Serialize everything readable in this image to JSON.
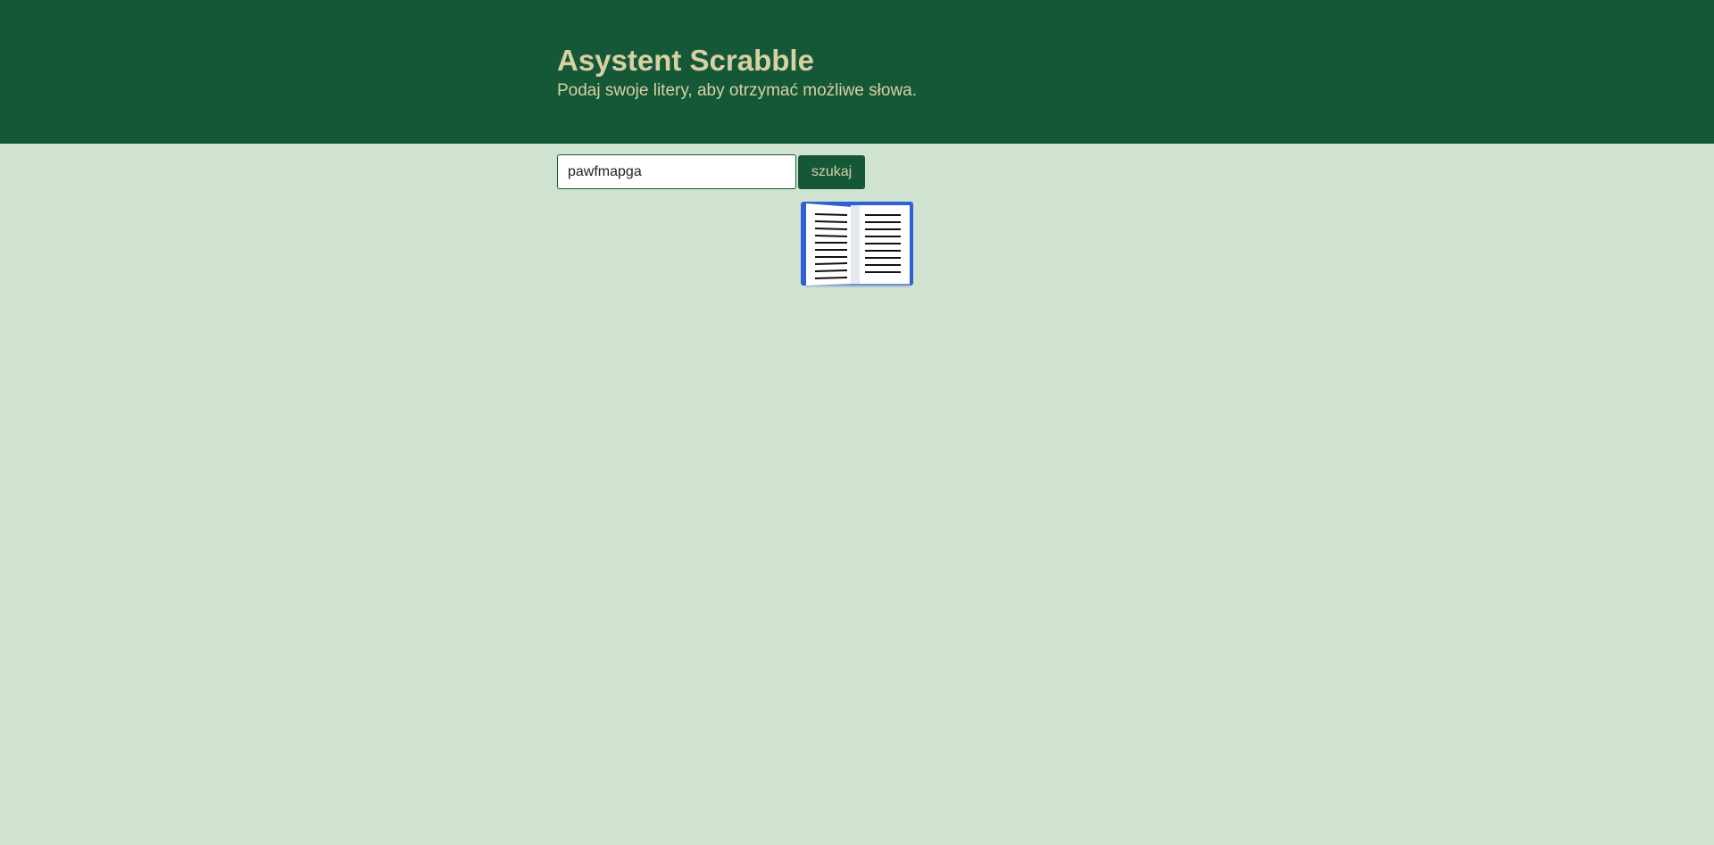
{
  "header": {
    "title": "Asystent Scrabble",
    "subtitle": "Podaj swoje litery, aby otrzymać możliwe słowa."
  },
  "search": {
    "value": "pawfmapga",
    "button_label": "szukaj"
  },
  "icons": {
    "loading": "open-book-icon"
  },
  "colors": {
    "header_bg": "#155838",
    "page_bg": "#cfe3d0",
    "header_text": "#d7d0a4",
    "book_cover": "#2f5fd8"
  }
}
